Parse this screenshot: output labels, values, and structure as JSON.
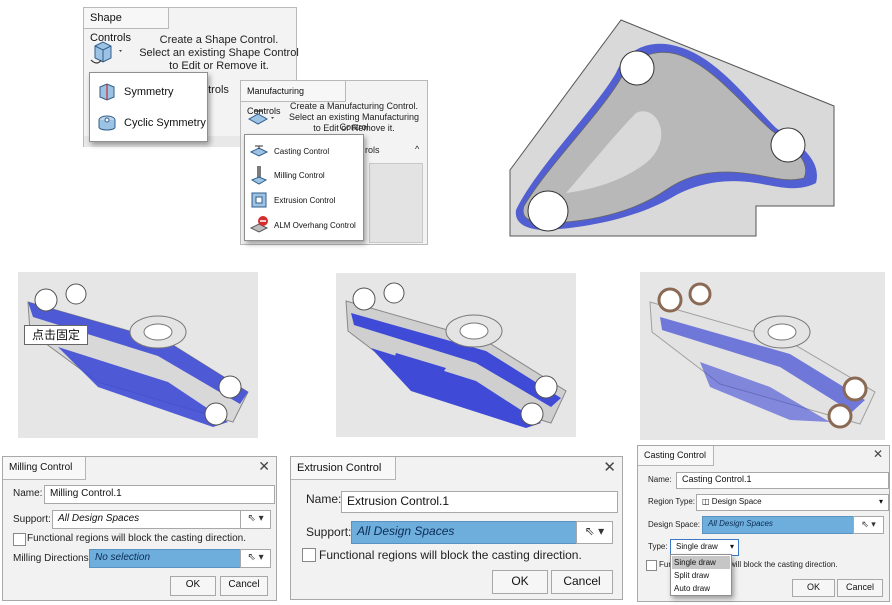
{
  "shape_controls": {
    "tab_label": "Shape Controls",
    "hint_line1": "Create a Shape Control.",
    "hint_line2": "Select an existing Shape Control",
    "hint_line3": "to Edit or Remove it.",
    "behind_label": "ntrols",
    "menu": [
      {
        "label": "Symmetry",
        "icon": "symmetry-icon"
      },
      {
        "label": "Cyclic Symmetry",
        "icon": "cyclic-symmetry-icon"
      }
    ]
  },
  "manufacturing_controls": {
    "tab_label": "Manufacturing Controls",
    "hint_line1": "Create a Manufacturing Control.",
    "hint_line2": "Select an existing Manufacturing Control",
    "hint_line3": "to Edit or Remove it.",
    "behind_label": "rols",
    "menu": [
      {
        "label": "Casting Control",
        "icon": "casting-control-icon"
      },
      {
        "label": "Milling Control",
        "icon": "milling-control-icon"
      },
      {
        "label": "Extrusion Control",
        "icon": "extrusion-control-icon"
      },
      {
        "label": "ALM Overhang Control",
        "icon": "alm-overhang-icon"
      }
    ]
  },
  "tooltip": {
    "text": "点击固定"
  },
  "milling_dialog": {
    "title": "Milling Control",
    "name_label": "Name:",
    "name_value": "Milling Control.1",
    "support_label": "Support:",
    "support_value": "All Design Spaces",
    "checkbox_label": "Functional regions will block the casting direction.",
    "directions_label": "Milling Directions:",
    "directions_value": "No selection",
    "ok": "OK",
    "cancel": "Cancel"
  },
  "extrusion_dialog": {
    "title": "Extrusion Control",
    "name_label": "Name:",
    "name_value": "Extrusion Control.1",
    "support_label": "Support:",
    "support_value": "All Design Spaces",
    "checkbox_label": "Functional regions will block the casting direction.",
    "ok": "OK",
    "cancel": "Cancel"
  },
  "casting_dialog": {
    "title": "Casting Control",
    "name_label": "Name:",
    "name_value": "Casting Control.1",
    "region_type_label": "Region Type:",
    "region_type_value": "Design Space",
    "design_space_label": "Design Space:",
    "design_space_value": "All Design Spaces",
    "type_label": "Type:",
    "type_value": "Single draw",
    "type_options": [
      "Single draw",
      "Split draw",
      "Auto draw"
    ],
    "checkbox_label_visible_left": "Fun",
    "checkbox_label_visible_right": "will block the casting direction.",
    "ok": "OK",
    "cancel": "Cancel"
  },
  "colors": {
    "accent_blue": "#6eaedc",
    "part_blue": "#3d46c9",
    "part_grey": "#bdbdbd"
  }
}
